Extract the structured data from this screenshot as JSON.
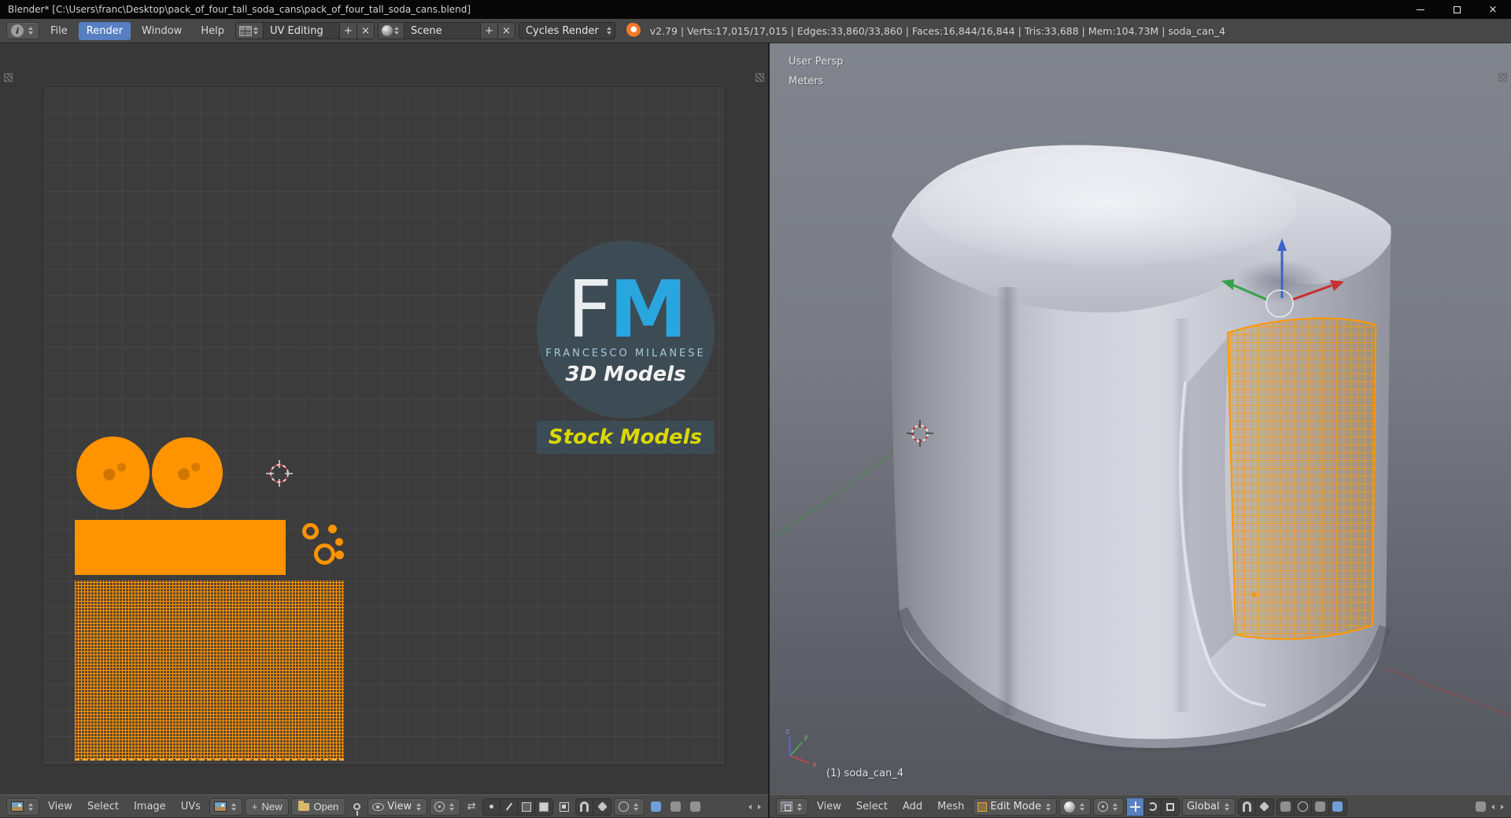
{
  "window": {
    "title": "Blender* [C:\\Users\\franc\\Desktop\\pack_of_four_tall_soda_cans\\pack_of_four_tall_soda_cans.blend]"
  },
  "icons": {
    "close": "×",
    "info": "i",
    "sync": "⇄",
    "plus": "+"
  },
  "info_bar": {
    "menus": [
      "File",
      "Render",
      "Window",
      "Help"
    ],
    "layout_name": "UV Editing",
    "scene_name": "Scene",
    "engine": "Cycles Render",
    "stats": "v2.79 | Verts:17,015/17,015 | Edges:33,860/33,860 | Faces:16,844/16,844 | Tris:33,688 | Mem:104.73M | soda_can_4"
  },
  "uv_editor": {
    "menus": [
      "View",
      "Select",
      "Image",
      "UVs"
    ],
    "new_label": "New",
    "open_label": "Open",
    "mode_label": "View"
  },
  "viewport": {
    "view_label": "User Persp",
    "units_label": "Meters",
    "object_label": "(1) soda_can_4",
    "menus": [
      "View",
      "Select",
      "Add",
      "Mesh"
    ],
    "mode_label": "Edit Mode",
    "orientation_label": "Global",
    "axis": {
      "x": "x",
      "y": "y",
      "z": "z"
    }
  },
  "logo": {
    "letter_f": "F",
    "letter_m": "M",
    "name": "FRANCESCO MILANESE",
    "tagline": "3D Models",
    "banner": "Stock Models"
  },
  "colors": {
    "selection_orange": "#ff9400",
    "active_menu_blue": "#5680c2",
    "logo_blue": "#2aa6de",
    "banner_yellow": "#dcd800",
    "logo_slate": "#3d4b54"
  }
}
